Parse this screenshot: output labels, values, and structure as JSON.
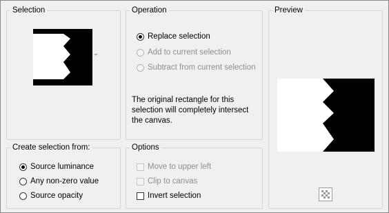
{
  "selection": {
    "title": "Selection"
  },
  "operation": {
    "title": "Operation",
    "options": [
      {
        "label": "Replace selection",
        "checked": true,
        "enabled": true
      },
      {
        "label": "Add to current selection",
        "checked": false,
        "enabled": false
      },
      {
        "label": "Subtract from current selection",
        "checked": false,
        "enabled": false
      }
    ],
    "message": "The original rectangle for this selection will completely intersect the canvas."
  },
  "preview": {
    "title": "Preview"
  },
  "create_from": {
    "title": "Create selection from:",
    "options": [
      {
        "label": "Source luminance",
        "checked": true
      },
      {
        "label": "Any non-zero value",
        "checked": false
      },
      {
        "label": "Source opacity",
        "checked": false
      }
    ]
  },
  "options": {
    "title": "Options",
    "items": [
      {
        "label": "Move to upper left",
        "checked": false,
        "enabled": false
      },
      {
        "label": "Clip to canvas",
        "checked": false,
        "enabled": false
      },
      {
        "label": "Invert selection",
        "checked": false,
        "enabled": true
      }
    ]
  },
  "colors": {
    "background": "#f0f0f0",
    "group_border": "#d5d5d5",
    "disabled_text": "#8e8e8e"
  }
}
